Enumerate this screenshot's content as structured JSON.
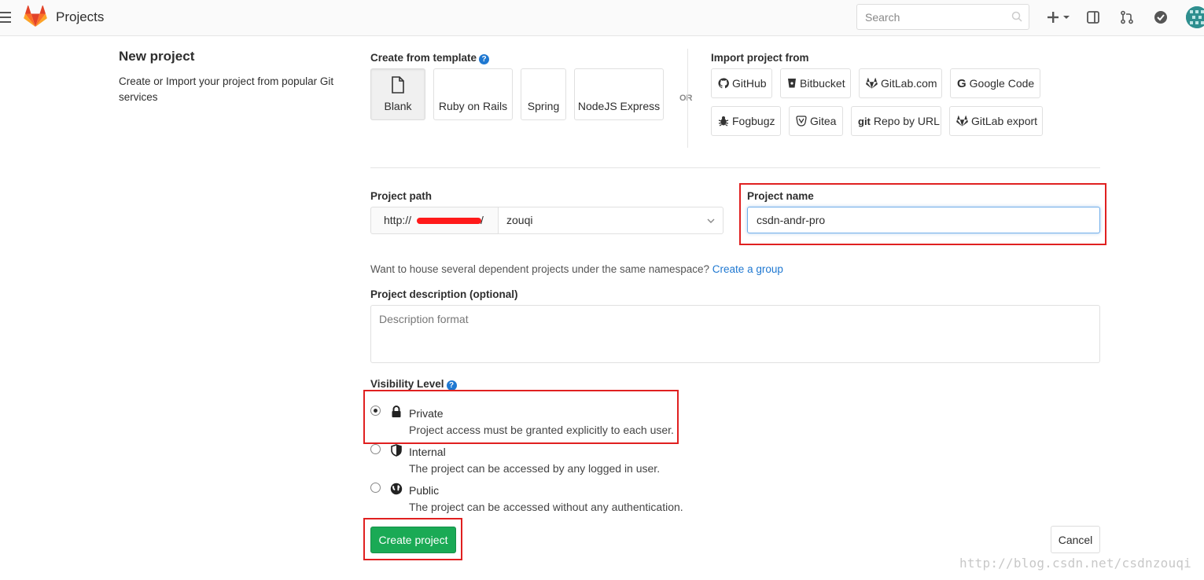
{
  "navbar": {
    "title": "Projects",
    "search_placeholder": "Search",
    "icons": [
      "menu-icon",
      "gitlab-logo-icon",
      "search-icon",
      "plus-icon",
      "chevron-down-icon",
      "sidebar-toggle-icon",
      "merge-request-icon",
      "todo-check-icon",
      "avatar"
    ]
  },
  "intro": {
    "title": "New project",
    "description": "Create or Import your project from popular Git services"
  },
  "templates": {
    "label": "Create from template",
    "items": [
      {
        "label": "Blank",
        "active": true
      },
      {
        "label": "Ruby on Rails"
      },
      {
        "label": "Spring"
      },
      {
        "label": "NodeJS Express"
      }
    ],
    "or_label": "OR"
  },
  "import": {
    "label": "Import project from",
    "items": [
      {
        "label": "GitHub",
        "icon": "github-icon"
      },
      {
        "label": "Bitbucket",
        "icon": "bitbucket-icon"
      },
      {
        "label": "GitLab.com",
        "icon": "gitlab-icon"
      },
      {
        "label": "Google Code",
        "icon": "google-icon"
      },
      {
        "label": "Fogbugz",
        "icon": "bug-icon"
      },
      {
        "label": "Gitea",
        "icon": "gitea-icon"
      },
      {
        "label": "Repo by URL",
        "icon": "git-icon"
      },
      {
        "label": "GitLab export",
        "icon": "gitlab-icon"
      }
    ]
  },
  "form": {
    "path_label": "Project path",
    "path_prefix": "http://",
    "path_slash": "/",
    "namespace": "zouqi",
    "name_label": "Project name",
    "name_value": "csdn-andr-pro",
    "hint_text": "Want to house several dependent projects under the same namespace?",
    "hint_link": "Create a group",
    "description_label": "Project description (optional)",
    "description_placeholder": "Description format"
  },
  "visibility": {
    "label": "Visibility Level",
    "options": [
      {
        "title": "Private",
        "description": "Project access must be granted explicitly to each user.",
        "checked": true,
        "icon": "lock-icon"
      },
      {
        "title": "Internal",
        "description": "The project can be accessed by any logged in user.",
        "checked": false,
        "icon": "shield-icon"
      },
      {
        "title": "Public",
        "description": "The project can be accessed without any authentication.",
        "checked": false,
        "icon": "globe-icon"
      }
    ]
  },
  "actions": {
    "create_label": "Create project",
    "cancel_label": "Cancel"
  },
  "colors": {
    "primary_green": "#1aaa55",
    "link_blue": "#1f78d1",
    "highlight_red": "#e02020"
  },
  "watermark": "http://blog.csdn.net/csdnzouqi"
}
